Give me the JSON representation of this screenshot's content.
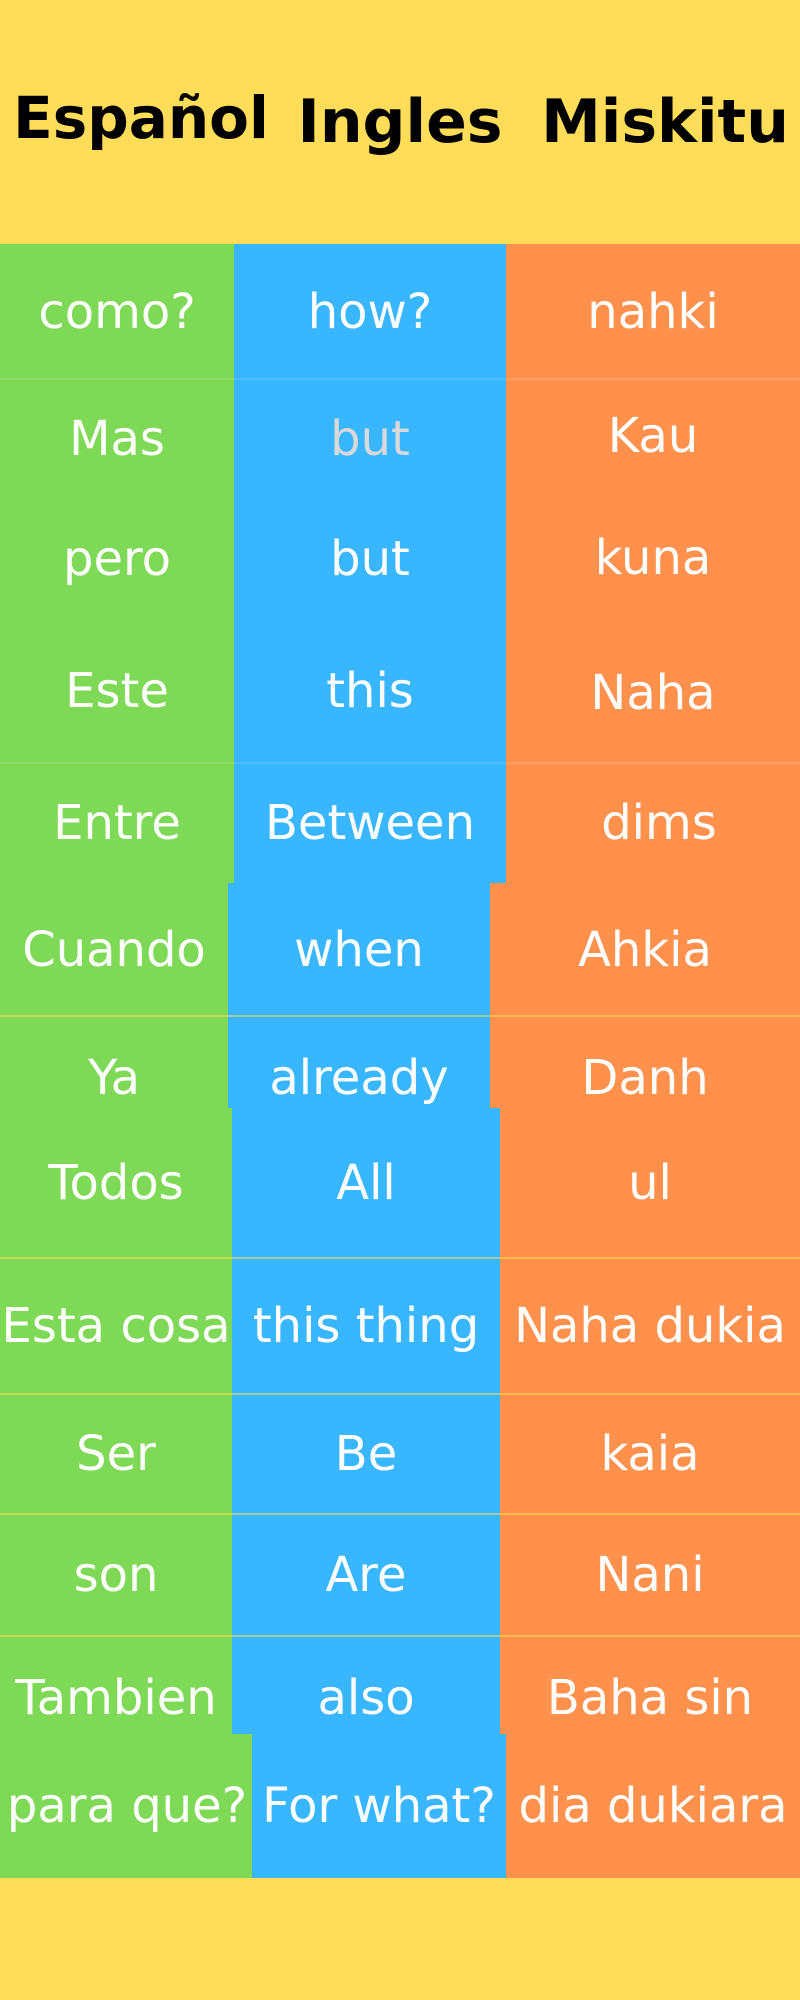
{
  "headers": {
    "spanish": "Español",
    "english": "Ingles",
    "miskitu": "Miskitu"
  },
  "rows": [
    {
      "es": "como?",
      "en": "how?",
      "mi": "nahki"
    },
    {
      "es": "Mas",
      "en": "but",
      "mi": "Kau"
    },
    {
      "es": "pero",
      "en": "but",
      "mi": "kuna"
    },
    {
      "es": "Este",
      "en": "this",
      "mi": "Naha"
    },
    {
      "es": "Entre",
      "en": "Between",
      "mi": "dims"
    },
    {
      "es": "Cuando",
      "en": "when",
      "mi": "Ahkia"
    },
    {
      "es": "Ya",
      "en": "already",
      "mi": "Danh"
    },
    {
      "es": "Todos",
      "en": "All",
      "mi": "ul"
    },
    {
      "es": "Esta cosa",
      "en": "this thing",
      "mi": "Naha dukia"
    },
    {
      "es": "Ser",
      "en": "Be",
      "mi": "kaia"
    },
    {
      "es": "son",
      "en": "Are",
      "mi": "Nani"
    },
    {
      "es": "Tambien",
      "en": "also",
      "mi": "Baha sin"
    },
    {
      "es": "para que?",
      "en": "For what?",
      "mi": "dia dukiara"
    }
  ],
  "colors": {
    "background": "#FFDD59",
    "spanish_column": "#7ED957",
    "english_column": "#38B6FF",
    "miskitu_column": "#FF914D"
  }
}
